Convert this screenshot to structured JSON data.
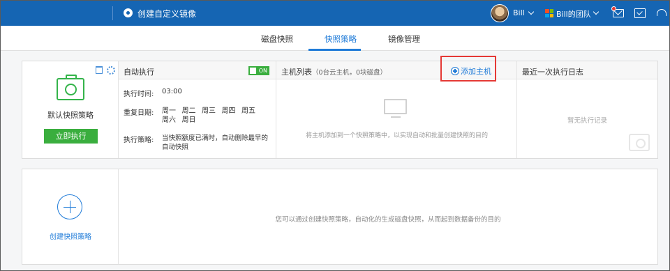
{
  "topbar": {
    "app_title": "创建自定义镜像",
    "user_name": "Bill",
    "team_name": "Bill的团队",
    "accent_color": "#1565b3",
    "icons": [
      "image-app-icon",
      "avatar",
      "windows-icon",
      "mail-icon",
      "task-icon",
      "headset-icon"
    ]
  },
  "tabs": [
    {
      "label": "磁盘快照",
      "active": false
    },
    {
      "label": "快照策略",
      "active": true
    },
    {
      "label": "镜像管理",
      "active": false
    }
  ],
  "policy": {
    "name": "默认快照策略",
    "run_label": "立即执行",
    "auto": {
      "title": "自动执行",
      "toggle_label": "ON",
      "time_label": "执行时间:",
      "time_value": "03:00",
      "repeat_label": "重复日期:",
      "days": [
        "周一",
        "周二",
        "周三",
        "周四",
        "周五",
        "周六",
        "周日"
      ],
      "strategy_label": "执行策略:",
      "strategy_value": "当快照额度已满时，自动删除最早的自动快照"
    },
    "hosts": {
      "title": "主机列表",
      "subtitle": "（0台云主机，0块磁盘）",
      "add_label": "添加主机",
      "empty_text": "将主机添加到一个快照策略中，以实现自动和批量创建快照的目的"
    },
    "log": {
      "title": "最近一次执行日志",
      "empty_text": "暂无执行记录"
    }
  },
  "create": {
    "label": "创建快照策略",
    "message": "您可以通过创建快照策略，自动化的生成磁盘快照，从而起到数据备份的目的"
  }
}
